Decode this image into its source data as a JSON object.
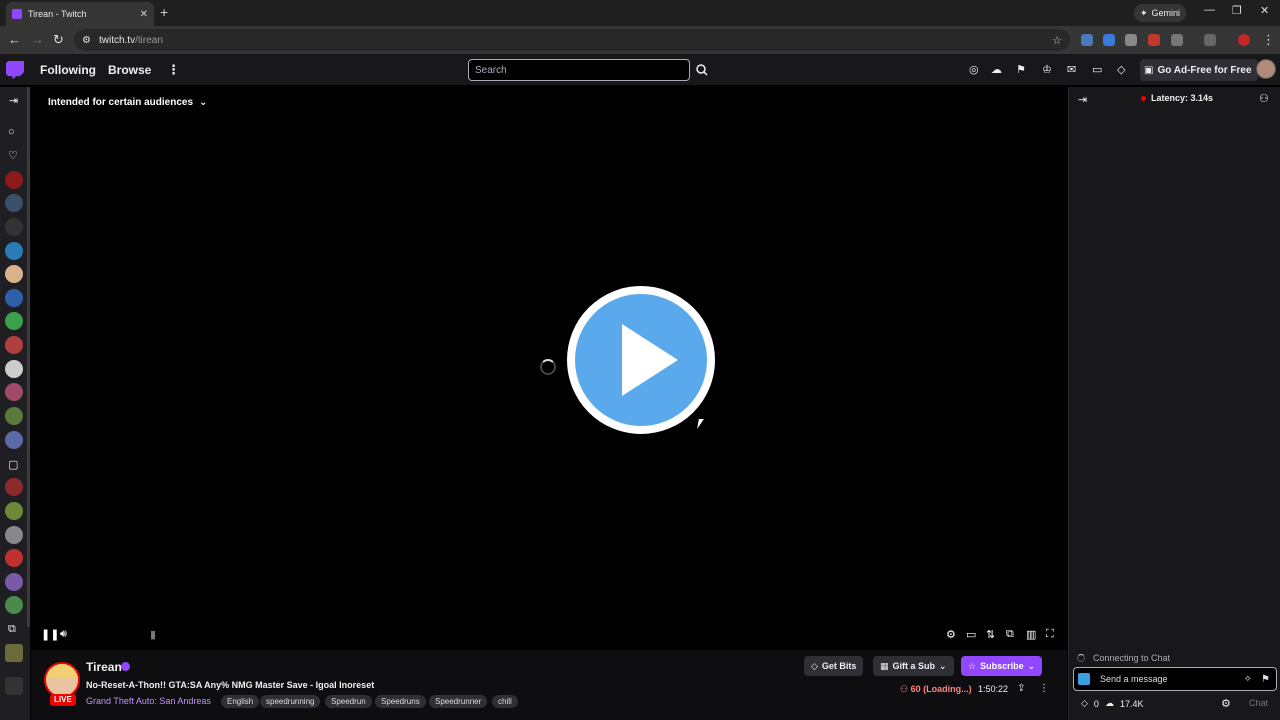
{
  "browser": {
    "tab_title": "Tirean - Twitch",
    "new_tab": "+",
    "gemini_label": "Gemini",
    "url_site": "twitch.tv",
    "url_path": "/tirean"
  },
  "topnav": {
    "following": "Following",
    "browse": "Browse",
    "search_placeholder": "Search",
    "adfree_label": "Go Ad-Free for Free"
  },
  "player": {
    "audience_label": "Intended for certain audiences"
  },
  "channel": {
    "name": "Tirean",
    "live_badge": "LIVE",
    "title": "No-Reset-A-Thon!! GTA:SA Any% NMG Master Save - Igoal Inoreset",
    "game": "Grand Theft Auto: San Andreas",
    "tags": [
      "English",
      "speedrunning",
      "Speedrun",
      "Speedruns",
      "Speedrunner",
      "chill"
    ],
    "get_bits": "Get Bits",
    "gift_sub": "Gift a Sub",
    "subscribe": "Subscribe",
    "viewers": "60 (Loading...)",
    "uptime": "1:50:22"
  },
  "chat": {
    "latency": "Latency: 3.14s",
    "connecting": "Connecting to Chat",
    "message_placeholder": "Send a message",
    "points": "0",
    "channel_points": "17.4K",
    "chat_button": "Chat"
  },
  "colors": {
    "twitch_purple": "#9146ff",
    "play_blue": "#5aa9ec",
    "live_red": "#eb0400"
  }
}
